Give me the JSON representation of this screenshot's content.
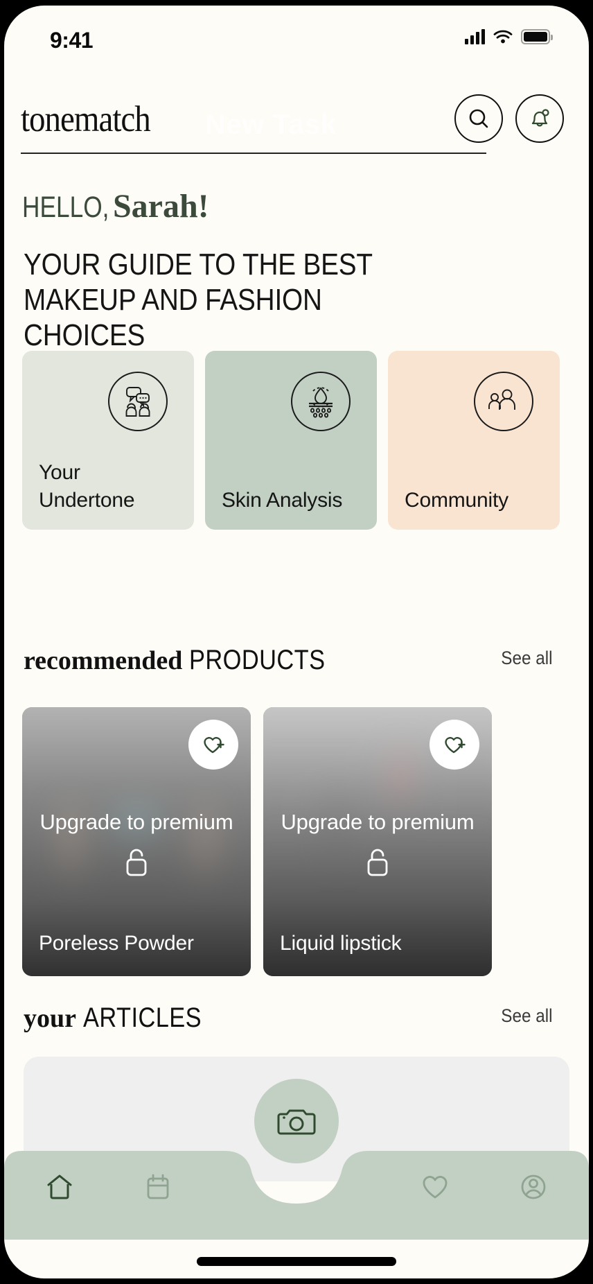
{
  "status_bar": {
    "time": "9:41",
    "signal_icon": "cellular-signal-icon",
    "wifi_icon": "wifi-icon",
    "battery_icon": "battery-icon"
  },
  "header": {
    "logo": "tonematch",
    "watermark": "New Task",
    "search_icon": "search-icon",
    "bell_icon": "notification-bell-icon"
  },
  "greeting": {
    "hello": "HELLO,",
    "name": "Sarah!",
    "tagline": "YOUR GUIDE TO THE BEST MAKEUP AND FASHION CHOICES"
  },
  "categories": [
    {
      "label": "Your\nUndertone",
      "icon": "chat-people-icon",
      "color": "#E2E6DD"
    },
    {
      "label": "Skin Analysis",
      "icon": "skin-hydration-icon",
      "color": "#C2CFC3"
    },
    {
      "label": "Community",
      "icon": "community-people-icon",
      "color": "#F9E4D1"
    }
  ],
  "products_section": {
    "title_serif": "recommended",
    "title_sans": "PRODUCTS",
    "see_all": "See all",
    "items": [
      {
        "name": "Poreless Powder",
        "upsell": "Upgrade to premium",
        "lock_icon": "unlock-icon",
        "fav_icon": "heart-plus-icon"
      },
      {
        "name": "Liquid lipstick",
        "upsell": "Upgrade to premium",
        "lock_icon": "unlock-icon",
        "fav_icon": "heart-plus-icon"
      }
    ]
  },
  "articles_section": {
    "title_serif": "your",
    "title_sans": "ARTICLES",
    "see_all": "See all"
  },
  "bottom_nav": {
    "camera_icon": "camera-icon",
    "items": [
      {
        "icon": "home-icon",
        "active": true
      },
      {
        "icon": "calendar-icon",
        "active": false
      },
      {
        "icon": "heart-icon",
        "active": false
      },
      {
        "icon": "profile-icon",
        "active": false
      }
    ]
  },
  "colors": {
    "background": "#FDFCF6",
    "sage": "#C2CFC3",
    "sage_light": "#E2E6DD",
    "peach": "#F9E4D1",
    "accent_green": "#2F4A2E",
    "text_dark": "#151515"
  }
}
